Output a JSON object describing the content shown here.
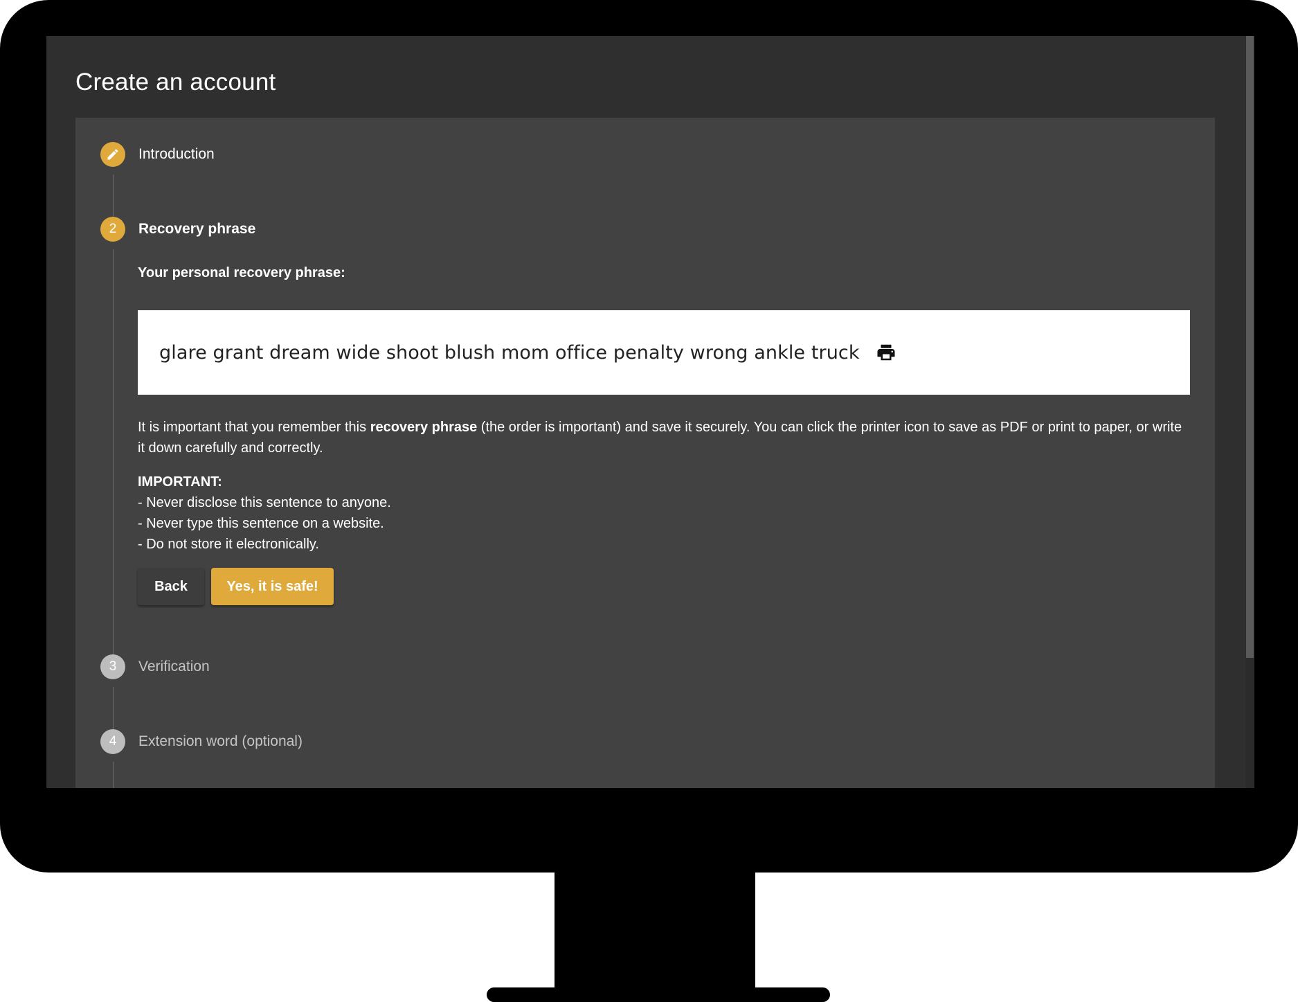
{
  "page": {
    "title": "Create an account"
  },
  "stepper": {
    "steps": [
      {
        "number": "",
        "label": "Introduction",
        "state": "done"
      },
      {
        "number": "2",
        "label": "Recovery phrase",
        "state": "active"
      },
      {
        "number": "3",
        "label": "Verification",
        "state": "pending"
      },
      {
        "number": "4",
        "label": "Extension word (optional)",
        "state": "pending"
      }
    ]
  },
  "recovery": {
    "heading": "Your personal recovery phrase:",
    "phrase": "glare grant dream wide shoot blush mom office penalty wrong ankle truck",
    "info_before": "It is important that you remember this ",
    "info_bold": "recovery phrase",
    "info_after": " (the order is important) and save it securely. You can click the printer icon to save as PDF or print to paper, or write it down carefully and correctly.",
    "important_title": "IMPORTANT:",
    "important_items": [
      "- Never disclose this sentence to anyone.",
      "- Never type this sentence on a website.",
      "- Do not store it electronically."
    ]
  },
  "buttons": {
    "back": "Back",
    "confirm": "Yes, it is safe!"
  },
  "colors": {
    "accent": "#e0a93b",
    "card_background": "#424242",
    "page_background": "#2f2f2f",
    "pending_step": "#bdbdbd"
  },
  "icons": {
    "step_done": "pencil-icon",
    "print": "printer-icon"
  }
}
